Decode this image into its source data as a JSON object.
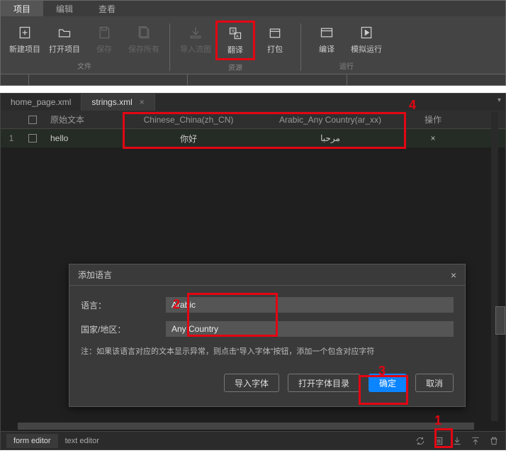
{
  "top_tabs": {
    "project": "项目",
    "edit": "编辑",
    "view": "查看"
  },
  "ribbon": {
    "new_project": "新建项目",
    "open_project": "打开项目",
    "save": "保存",
    "save_all": "保存所有",
    "import_flow": "导入流图",
    "translate": "翻译",
    "pack": "打包",
    "compile": "编译",
    "simulate": "模拟运行",
    "group_file": "文件",
    "group_resource": "资源",
    "group_run": "运行"
  },
  "filetabs": {
    "home": "home_page.xml",
    "strings": "strings.xml"
  },
  "grid": {
    "ln": "1",
    "header_orig": "原始文本",
    "header_zh": "Chinese_China(zh_CN)",
    "header_ar": "Arabic_Any Country(ar_xx)",
    "header_op": "操作",
    "row_orig": "hello",
    "row_zh": "你好",
    "row_ar": "مرحبا"
  },
  "dialog": {
    "title": "添加语言",
    "lang_label": "语言：",
    "lang_value": "Arabic",
    "region_label": "国家/地区：",
    "region_value": "Any Country",
    "note": "注：如果该语言对应的文本显示异常，则点击“导入字体”按钮，添加一个包含对应字符",
    "btn_import": "导入字体",
    "btn_open": "打开字体目录",
    "btn_ok": "确定",
    "btn_cancel": "取消"
  },
  "status": {
    "form": "form editor",
    "text": "text editor"
  },
  "ann": {
    "1": "1",
    "2": "2",
    "3": "3",
    "4": "4"
  }
}
